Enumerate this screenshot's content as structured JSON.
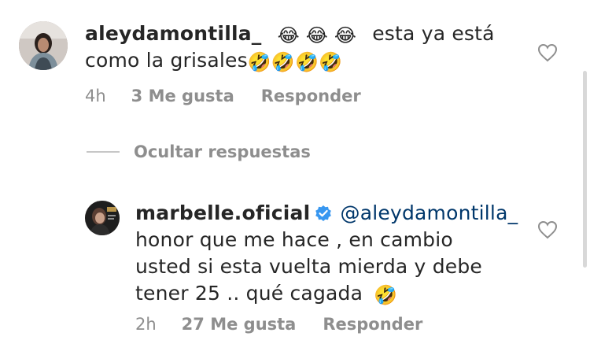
{
  "comments": [
    {
      "username": "aleydamontilla_",
      "emoji_head": "😂 😂 😂",
      "text_line1": "esta ya está",
      "text_line2": "como la grisales",
      "emoji_tail": "🤣🤣🤣🤣",
      "time": "4h",
      "likes": "3 Me gusta",
      "reply_label": "Responder"
    }
  ],
  "hide_replies_label": "Ocultar respuestas",
  "reply": {
    "username": "marbelle.oficial",
    "mention": "@aleydamontilla_",
    "line1": "honor que me hace , en cambio",
    "line2": "usted si esta vuelta mierda y debe",
    "line3": "tener 25 .. qué cagada",
    "emoji_tail": "🤣",
    "time": "2h",
    "likes": "27 Me gusta",
    "reply_label": "Responder"
  },
  "colors": {
    "text": "#262626",
    "muted": "#8e8e8e",
    "mention": "#00376b",
    "verified": "#3897f0"
  },
  "icons": [
    "heart-icon",
    "verified-icon"
  ]
}
